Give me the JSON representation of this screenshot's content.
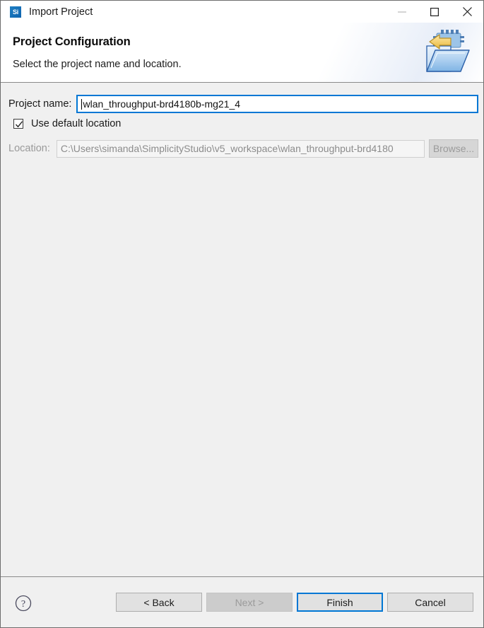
{
  "window": {
    "title": "Import Project",
    "app_icon_text": "Si",
    "controls": {
      "minimize": "minimize-icon",
      "maximize": "maximize-icon",
      "close": "close-icon"
    }
  },
  "header": {
    "title": "Project Configuration",
    "subtitle": "Select the project name and location.",
    "banner_icon": "import-folder-icon"
  },
  "form": {
    "project_name": {
      "label": "Project name:",
      "value": "wlan_throughput-brd4180b-mg21_4",
      "placeholder": "",
      "focused": true
    },
    "use_default_location": {
      "label": "Use default location",
      "checked": true
    },
    "location": {
      "label": "Location:",
      "value": "C:\\Users\\simanda\\SimplicityStudio\\v5_workspace\\wlan_throughput-brd4180",
      "disabled": true
    },
    "browse_button": {
      "label": "Browse...",
      "disabled": true
    }
  },
  "footer": {
    "help_icon": "help-icon",
    "back_button": {
      "label": "< Back",
      "disabled": false
    },
    "next_button": {
      "label": "Next >",
      "disabled": true
    },
    "finish_button": {
      "label": "Finish",
      "default": true
    },
    "cancel_button": {
      "label": "Cancel",
      "disabled": false
    }
  },
  "colors": {
    "accent": "#0077d4",
    "brand_blue": "#1e7fc4",
    "dialog_bg": "#f0f0f0",
    "header_bg": "#ffffff",
    "disabled_text": "#9b9b9b"
  }
}
